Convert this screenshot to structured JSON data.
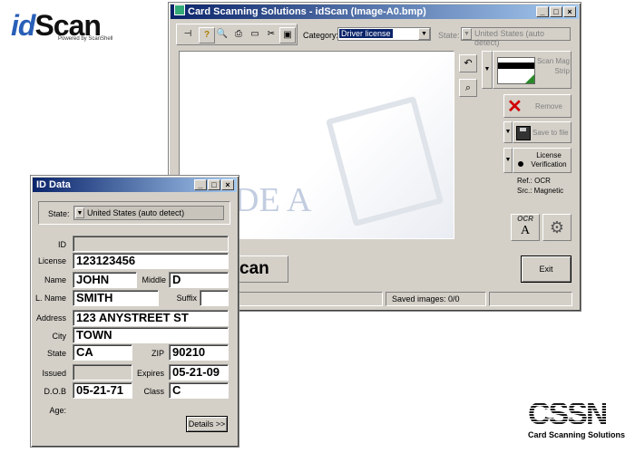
{
  "logo": {
    "word_id": "id",
    "word_scan": "Scan",
    "powered": "Powered by ScanShell"
  },
  "main_window": {
    "title": "Card Scanning Solutions - idScan (Image-A0.bmp)",
    "category_label": "Category:",
    "category_value": "Driver license",
    "state_label": "State:",
    "state_value": "United States (auto detect)",
    "scan_mag_strip": "Scan Mag Strip",
    "remove": "Remove",
    "save_to_file": "Save to file",
    "license_verification": "License Verification",
    "ref": "Ref.: OCR",
    "src": "Src.: Magnetic",
    "exit": "Exit",
    "watermark": "DE A",
    "partial_logo": "can",
    "status_saved": "Saved images:  0/0",
    "ocr_label": "OCR"
  },
  "id_window": {
    "title": "ID Data",
    "state_label": "State:",
    "state_value": "United States (auto detect)",
    "fields": {
      "id_label": "ID",
      "id_value": "",
      "license_label": "License",
      "license_value": "123123456",
      "name_label": "Name",
      "name_value": "JOHN",
      "middle_label": "Middle",
      "middle_value": "D",
      "lname_label": "L. Name",
      "lname_value": "SMITH",
      "suffix_label": "Suffix",
      "suffix_value": "",
      "address_label": "Address",
      "address_value": "123 ANYSTREET ST",
      "city_label": "City",
      "city_value": "TOWN",
      "state_label": "State",
      "state_value": "CA",
      "zip_label": "ZIP",
      "zip_value": "90210",
      "issued_label": "Issued",
      "issued_value": "",
      "expires_label": "Expires",
      "expires_value": "05-21-09",
      "dob_label": "D.O.B",
      "dob_value": "05-21-71",
      "class_label": "Class",
      "class_value": "C",
      "age_label": "Age:"
    },
    "details_button": "Details >>"
  },
  "cssn_logo": {
    "mark": "CSSN",
    "tagline": "Card Scanning Solutions"
  }
}
